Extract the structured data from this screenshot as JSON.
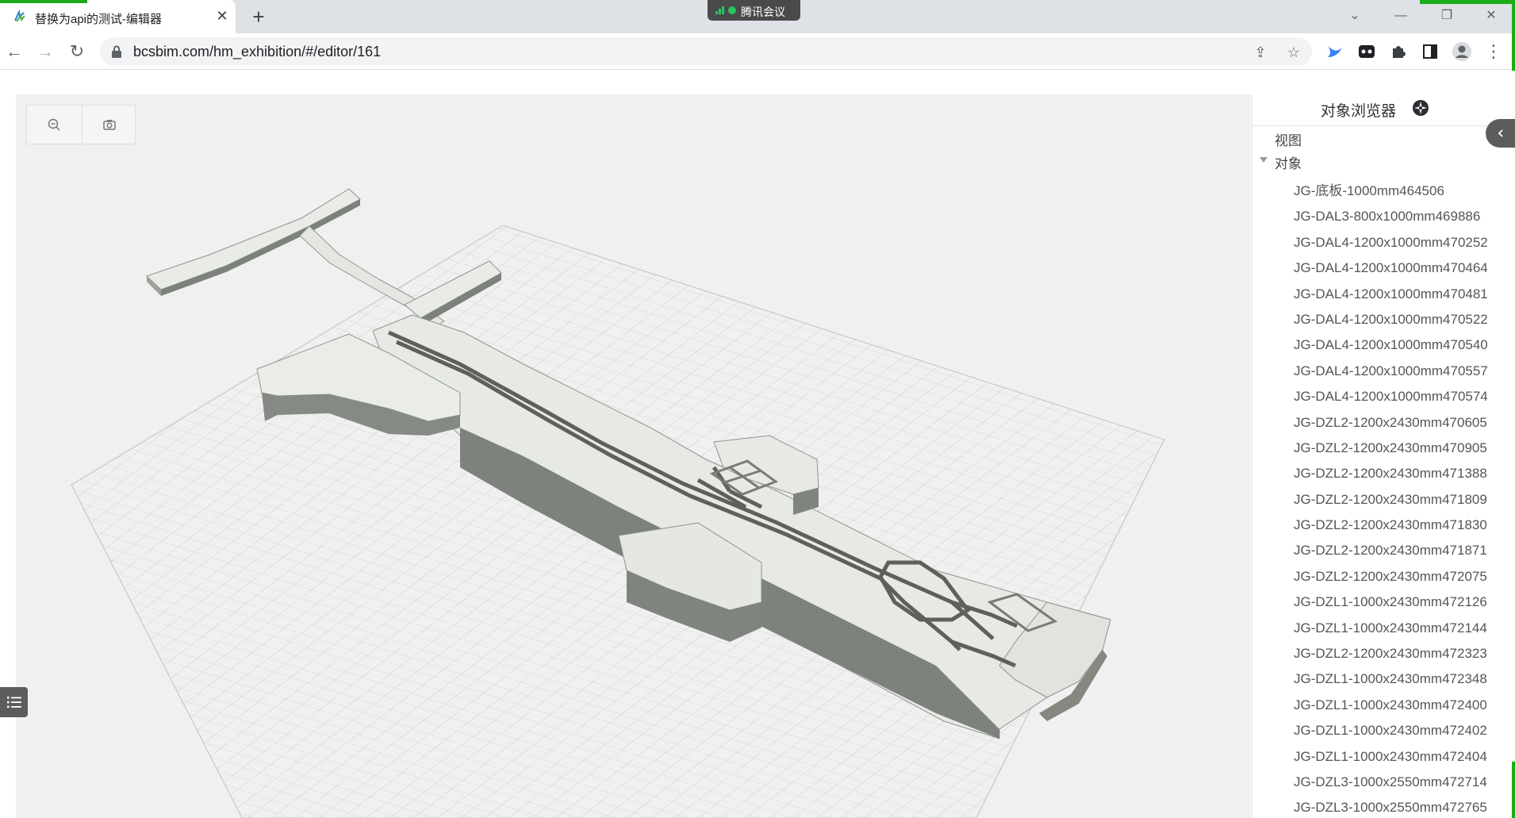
{
  "browser": {
    "tab_title": "替换为api的测试-编辑器",
    "tab_close_glyph": "✕",
    "new_tab_glyph": "+",
    "url": "bcsbim.com/hm_exhibition/#/editor/161",
    "meeting_label": "腾讯会议",
    "accent_color": "#1aad19"
  },
  "viewer": {
    "tools": [
      {
        "name": "zoom-out-icon"
      },
      {
        "name": "camera-icon"
      }
    ],
    "background": "#f0f0f0"
  },
  "panel": {
    "title": "对象浏览器",
    "view_label": "视图",
    "objects_label": "对象",
    "objects": [
      "JG-底板-1000mm464506",
      "JG-DAL3-800x1000mm469886",
      "JG-DAL4-1200x1000mm470252",
      "JG-DAL4-1200x1000mm470464",
      "JG-DAL4-1200x1000mm470481",
      "JG-DAL4-1200x1000mm470522",
      "JG-DAL4-1200x1000mm470540",
      "JG-DAL4-1200x1000mm470557",
      "JG-DAL4-1200x1000mm470574",
      "JG-DZL2-1200x2430mm470605",
      "JG-DZL2-1200x2430mm470905",
      "JG-DZL2-1200x2430mm471388",
      "JG-DZL2-1200x2430mm471809",
      "JG-DZL2-1200x2430mm471830",
      "JG-DZL2-1200x2430mm471871",
      "JG-DZL2-1200x2430mm472075",
      "JG-DZL1-1000x2430mm472126",
      "JG-DZL1-1000x2430mm472144",
      "JG-DZL2-1200x2430mm472323",
      "JG-DZL1-1000x2430mm472348",
      "JG-DZL1-1000x2430mm472400",
      "JG-DZL1-1000x2430mm472402",
      "JG-DZL1-1000x2430mm472404",
      "JG-DZL3-1000x2550mm472714",
      "JG-DZL3-1000x2550mm472765"
    ]
  }
}
